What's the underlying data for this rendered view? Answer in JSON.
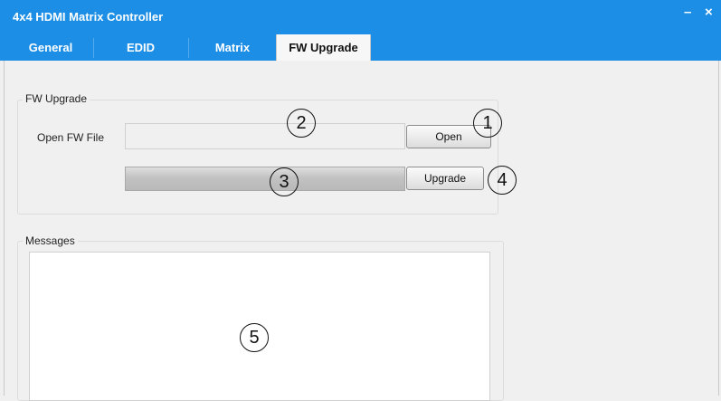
{
  "window": {
    "title": "4x4 HDMI Matrix Controller",
    "minimize_glyph": "–",
    "close_glyph": "×"
  },
  "tabs": [
    {
      "label": "General",
      "active": false
    },
    {
      "label": "EDID",
      "active": false
    },
    {
      "label": "Matrix",
      "active": false
    },
    {
      "label": "FW Upgrade",
      "active": true
    }
  ],
  "fw_upgrade": {
    "group_label": "FW Upgrade",
    "open_file_label": "Open FW File",
    "file_path_value": "",
    "open_button": "Open",
    "upgrade_button": "Upgrade",
    "progress": 0
  },
  "messages": {
    "group_label": "Messages",
    "text": ""
  },
  "callouts": [
    "1",
    "2",
    "3",
    "4",
    "5"
  ],
  "colors": {
    "titlebar": "#1c8ee6",
    "tab_active_bg": "#f7f7f7",
    "panel_bg": "#f0f0f0"
  }
}
